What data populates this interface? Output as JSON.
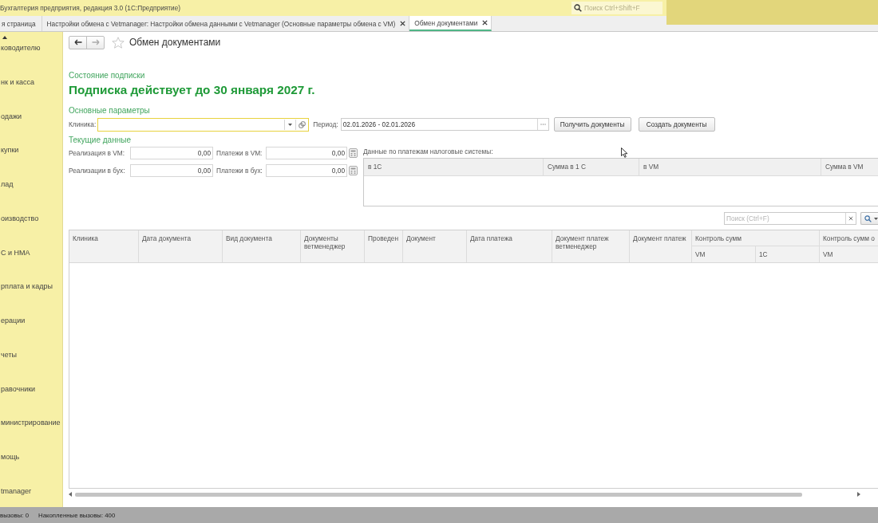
{
  "window": {
    "title": "Бухгалтерия предприятия, редакция 3.0  (1С:Предприятие)",
    "search": {
      "placeholder": "Поиск Ctrl+Shift+F"
    }
  },
  "tabs": [
    {
      "label": "я страница",
      "selected": false,
      "closable": false
    },
    {
      "label": "Настройки обмена с Vetmanager: Настройки обмена данными с Vetmanager (Основные параметры обмена с VM)",
      "selected": false,
      "closable": true
    },
    {
      "label": "Обмен документами",
      "selected": true,
      "closable": true
    }
  ],
  "sidebar": {
    "items": [
      {
        "label": "ководителю"
      },
      {
        "label": "нк и касса"
      },
      {
        "label": "одажи"
      },
      {
        "label": "купки"
      },
      {
        "label": "лад"
      },
      {
        "label": "оизводство"
      },
      {
        "label": "С и НМА"
      },
      {
        "label": "рплата и кадры"
      },
      {
        "label": "ерации"
      },
      {
        "label": "четы"
      },
      {
        "label": "равочники"
      },
      {
        "label": "министрирование"
      },
      {
        "label": "мощь"
      },
      {
        "label": "tmanager"
      }
    ]
  },
  "form": {
    "title": "Обмен документами",
    "subscription": {
      "heading": "Состояние подписки",
      "status": "Подписка действует до 30 января 2027 г."
    },
    "main_parameters": {
      "heading": "Основные параметры",
      "clinic": {
        "label": "Клиника:",
        "focused": true
      },
      "period": {
        "label": "Период:",
        "value": "02.01.2026 - 02.01.2026"
      },
      "buttons": [
        {
          "label": "Получить документы"
        },
        {
          "label": "Создать документы"
        }
      ]
    },
    "current_data": {
      "heading": "Текущие данные",
      "fields": [
        {
          "label": "Реализация в VM:",
          "value": "0,00",
          "kind": "number"
        },
        {
          "label": "Платежи в VM:",
          "value": "0,00",
          "kind": "calculator"
        },
        {
          "label": "Реализации в бух:",
          "value": "0,00",
          "kind": "number"
        },
        {
          "label": "Платежи в бух:",
          "value": "0,00",
          "kind": "calculator"
        }
      ]
    },
    "payments_table": {
      "caption": "Данные по платежам налоговые системы:",
      "columns": [
        "в 1С",
        "Сумма в 1 С",
        "в VM",
        "Сумма в VM"
      ]
    },
    "documents_table": {
      "search": {
        "placeholder": "Поиск (Ctrl+F)"
      },
      "columns": [
        {
          "label": "Клиника"
        },
        {
          "label": "Дата документа"
        },
        {
          "label": "Вид документа"
        },
        {
          "label": "Документы ветменеджер"
        },
        {
          "label": "Проведен"
        },
        {
          "label": "Документ"
        },
        {
          "label": "Дата платежа"
        },
        {
          "label": "Документ платеж ветменеджер"
        },
        {
          "label": "Документ платеж"
        },
        {
          "label": "Контроль сумм",
          "children": [
            "VM",
            "1С"
          ]
        },
        {
          "label": "Контроль сумм о",
          "children": [
            "VM"
          ]
        }
      ]
    }
  },
  "status_bar": {
    "items": [
      "вызовы: 0",
      "Накопленные вызовы: 400"
    ]
  }
}
